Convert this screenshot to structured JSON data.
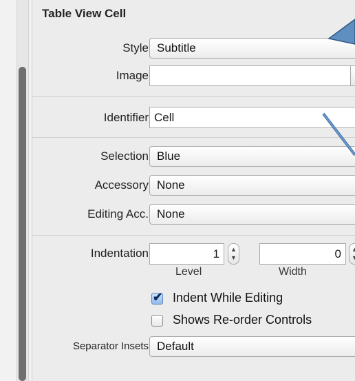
{
  "section_title": "Table View Cell",
  "fields": {
    "style": {
      "label": "Style",
      "value": "Subtitle"
    },
    "image": {
      "label": "Image",
      "value": ""
    },
    "identifier": {
      "label": "Identifier",
      "value": "Cell"
    },
    "selection": {
      "label": "Selection",
      "value": "Blue"
    },
    "accessory": {
      "label": "Accessory",
      "value": "None"
    },
    "editing_acc": {
      "label": "Editing Acc.",
      "value": "None"
    },
    "indentation": {
      "label": "Indentation",
      "level_value": "1",
      "width_value": "0",
      "level_label": "Level",
      "width_label": "Width"
    },
    "separator_insets": {
      "label": "Separator Insets",
      "value": "Default"
    }
  },
  "checkboxes": {
    "indent_while_editing": {
      "label": "Indent While Editing",
      "checked": true
    },
    "shows_reorder": {
      "label": "Shows Re-order Controls",
      "checked": false
    }
  },
  "glyphs": {
    "popup_arrows": "÷",
    "combo_arrow": "▼",
    "check_mark": "✔",
    "stepper_up": "▲",
    "stepper_down": "▼"
  },
  "colors": {
    "annotation_arrow": "#3f6fa0",
    "checkbox_fill": "#8fb9ec"
  }
}
